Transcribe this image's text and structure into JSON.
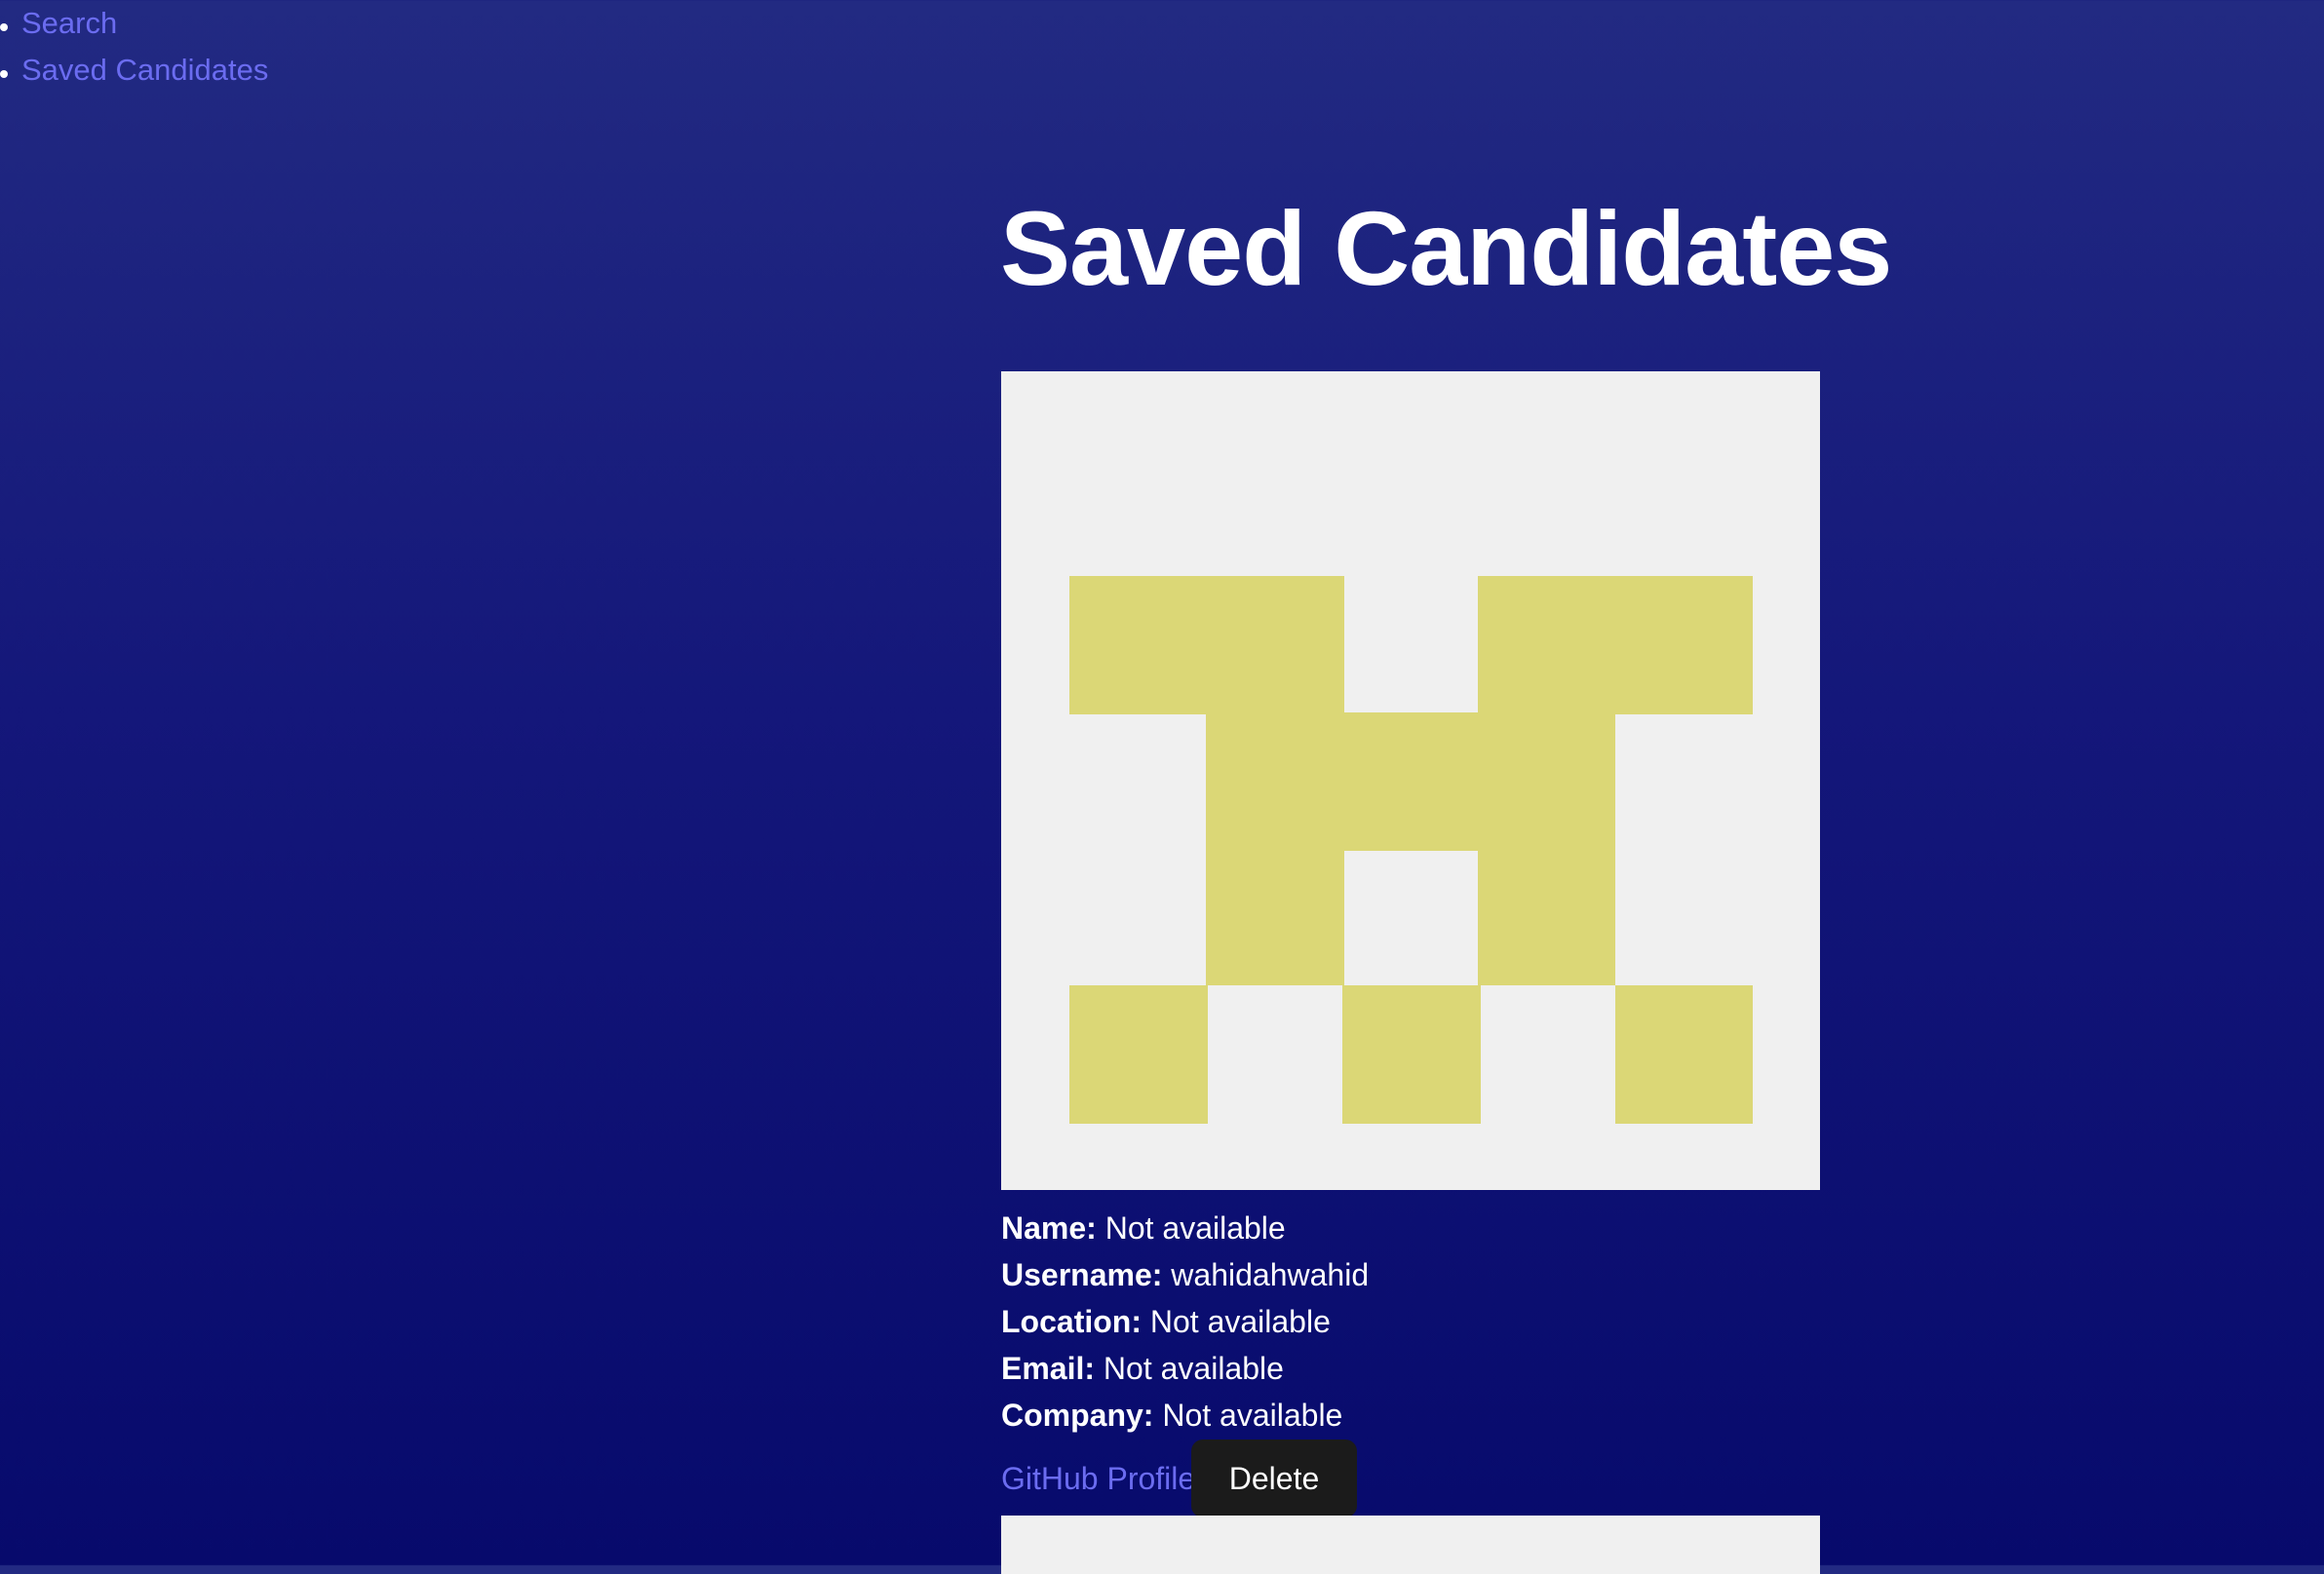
{
  "nav": {
    "items": [
      {
        "label": "Search"
      },
      {
        "label": "Saved Candidates"
      }
    ]
  },
  "page": {
    "title": "Saved Candidates"
  },
  "candidates": [
    {
      "avatar": {
        "icon": "identicon-avatar",
        "background_color": "#f0f0f0",
        "pattern_color": "#dbd776"
      },
      "fields": {
        "name_label": "Name:",
        "name_value": "Not available",
        "username_label": "Username:",
        "username_value": "wahidahwahid",
        "location_label": "Location:",
        "location_value": "Not available",
        "email_label": "Email:",
        "email_value": "Not available",
        "company_label": "Company:",
        "company_value": "Not available"
      },
      "github_link_label": "GitHub Profile",
      "delete_label": "Delete"
    }
  ],
  "colors": {
    "background_top": "#222a82",
    "background_bottom": "#070a6c",
    "link": "#6b6cf0",
    "button_bg": "#1b1b1b"
  }
}
